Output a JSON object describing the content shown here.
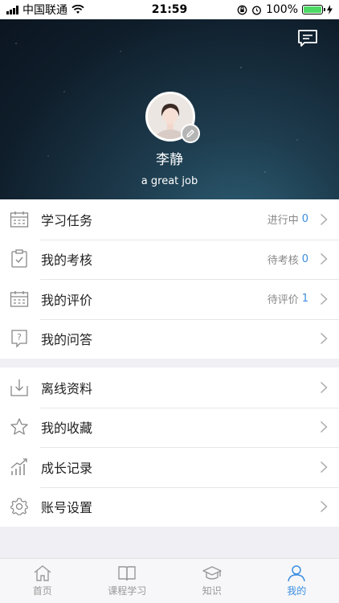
{
  "status_bar": {
    "carrier": "中国联通",
    "time": "21:59",
    "battery": "100%"
  },
  "profile": {
    "name": "李静",
    "motto": "a great job"
  },
  "menu_group_1": [
    {
      "label": "学习任务",
      "status": "进行中",
      "count": "0",
      "icon": "calendar-icon"
    },
    {
      "label": "我的考核",
      "status": "待考核",
      "count": "0",
      "icon": "clipboard-check-icon"
    },
    {
      "label": "我的评价",
      "status": "待评价",
      "count": "1",
      "icon": "calendar-icon"
    },
    {
      "label": "我的问答",
      "icon": "question-box-icon"
    }
  ],
  "menu_group_2": [
    {
      "label": "离线资料",
      "icon": "download-tray-icon"
    },
    {
      "label": "我的收藏",
      "icon": "star-icon"
    },
    {
      "label": "成长记录",
      "icon": "growth-chart-icon"
    },
    {
      "label": "账号设置",
      "icon": "gear-icon"
    }
  ],
  "tab_bar": [
    {
      "label": "首页",
      "icon": "home-icon"
    },
    {
      "label": "课程学习",
      "icon": "book-icon"
    },
    {
      "label": "知识",
      "icon": "graduation-cap-icon"
    },
    {
      "label": "我的",
      "icon": "person-icon",
      "active": true
    }
  ],
  "colors": {
    "accent": "#3b8ee0",
    "header_bg": "#0f1d2a",
    "page_bg": "#efeff4"
  }
}
